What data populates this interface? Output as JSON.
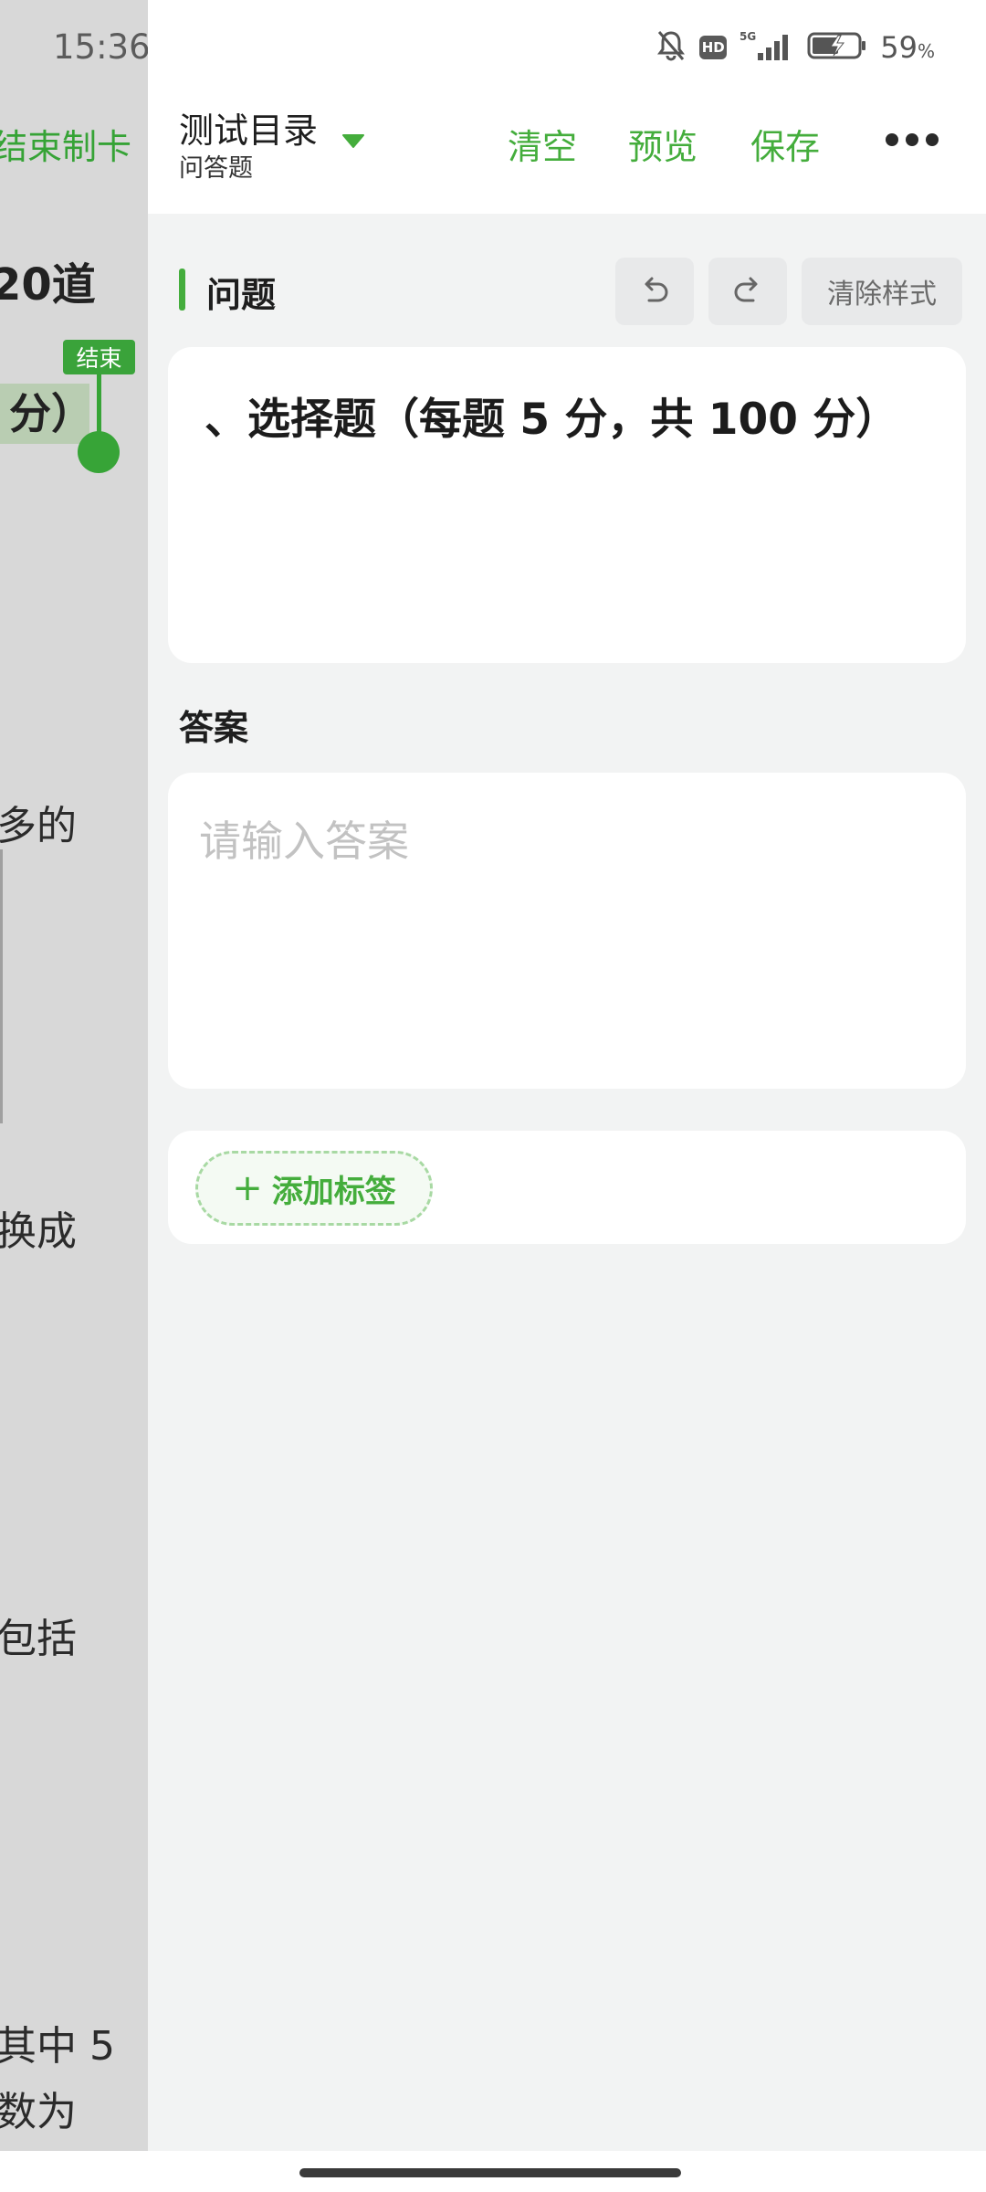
{
  "status_bar": {
    "time": "15:36",
    "network": "5G",
    "hd": "HD",
    "battery_percent": "59",
    "battery_unit": "%"
  },
  "background_document": {
    "finish_link": "结束制卡",
    "heading_fragment": "20道",
    "highlight_fragment": "分）",
    "end_badge": "结束",
    "fragments": [
      "多的",
      "换成",
      "包括",
      "其中 5",
      "数为"
    ]
  },
  "header": {
    "directory_title": "测试目录",
    "directory_subtitle": "问答题",
    "clear_label": "清空",
    "preview_label": "预览",
    "save_label": "保存"
  },
  "question_section": {
    "label": "问题",
    "clear_style_label": "清除样式",
    "content": "、选择题（每题 5 分，共 100 分）"
  },
  "answer_section": {
    "label": "答案",
    "placeholder": "请输入答案",
    "value": ""
  },
  "tags": {
    "add_label": "添加标签"
  },
  "colors": {
    "accent": "#44ad3c",
    "panel_bg": "#f2f3f3",
    "card_bg": "#ffffff",
    "left_overlay": "#d8d8d8"
  }
}
